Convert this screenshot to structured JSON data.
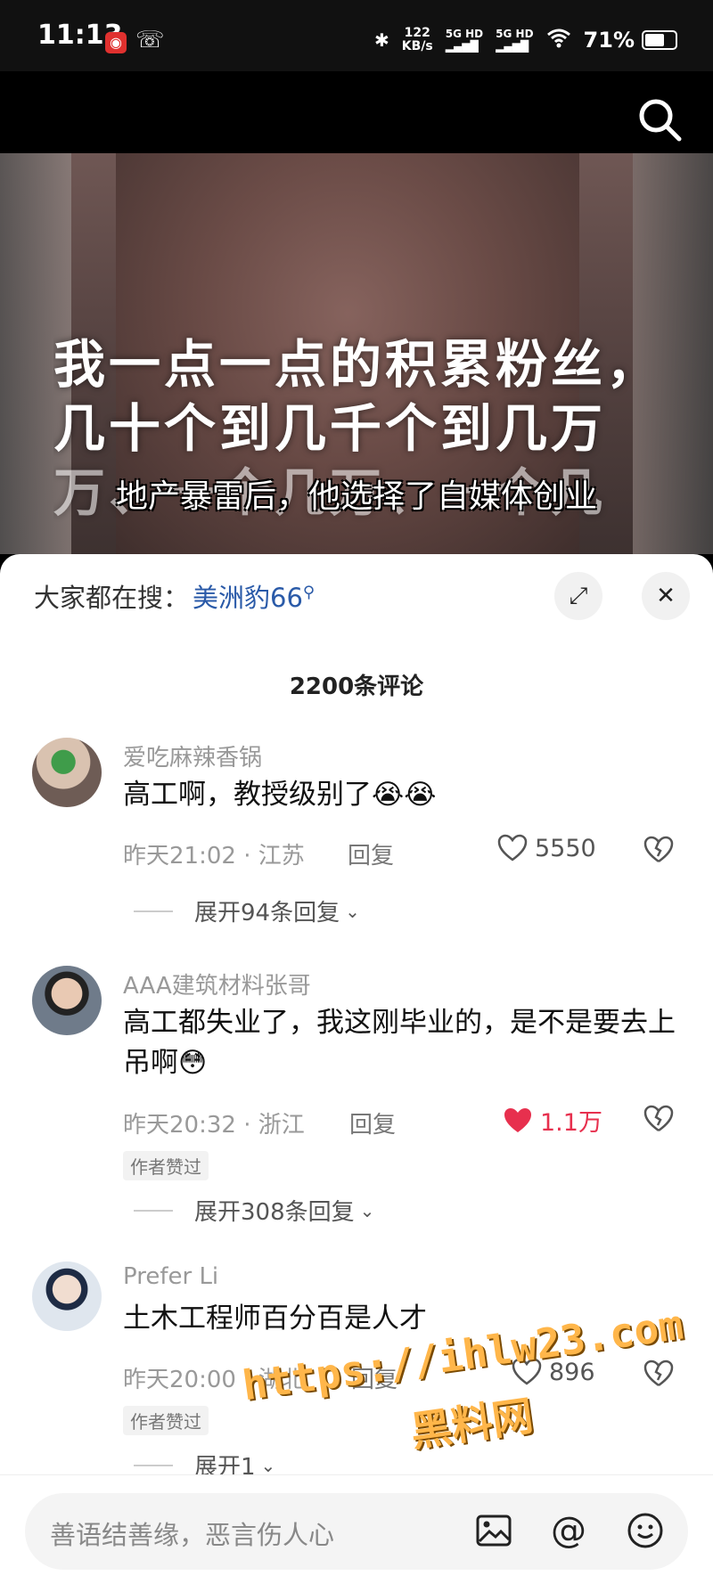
{
  "status_bar": {
    "time": "11:13",
    "net_speed_value": "122",
    "net_speed_unit": "KB/s",
    "signal_1": "5G HD",
    "signal_2": "5G HD",
    "battery": "71%",
    "battery_level": 0.71
  },
  "video": {
    "overlay_lines": [
      "我一点一点的积累粉丝，",
      "几十个到几千个到几万",
      "万、一个几万、一个几"
    ],
    "caption": "地产暴雷后，他选择了自媒体创业"
  },
  "comments_panel": {
    "suggest_label": "大家都在搜：",
    "suggest_term": "美洲豹66",
    "count_label": "2200条评论"
  },
  "comments": [
    {
      "username": "爱吃麻辣香锅",
      "text": "高工啊，教授级别了😭😭",
      "time": "昨天21:02 · 江苏",
      "reply_label": "回复",
      "likes": "5550",
      "liked": false,
      "expand_label": "展开94条回复"
    },
    {
      "username": "AAA建筑材料张哥",
      "text": "高工都失业了，我这刚毕业的，是不是要去上吊啊😳",
      "time": "昨天20:32 · 浙江",
      "reply_label": "回复",
      "likes": "1.1万",
      "liked": true,
      "badge": "作者赞过",
      "expand_label": "展开308条回复"
    },
    {
      "username": "Prefer Li",
      "text": "土木工程师百分百是人才",
      "time": "昨天20:00 · 湖北",
      "reply_label": "回复",
      "likes": "896",
      "liked": false,
      "badge": "作者赞过",
      "expand_label": "展开1"
    }
  ],
  "input_bar": {
    "placeholder": "善语结善缘，恶言伤人心"
  },
  "watermark": {
    "url": "https://ihlw23.com",
    "name": "黑料网"
  },
  "colors": {
    "accent_link": "#2a5aa8",
    "liked_red": "#e7304e",
    "watermark_orange": "#ffb64a"
  }
}
